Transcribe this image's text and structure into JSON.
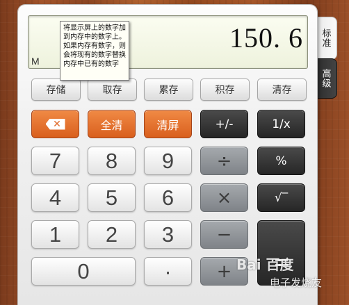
{
  "tabs": {
    "standard": "标准",
    "advanced": "高级"
  },
  "display": {
    "value": "150. 6",
    "memory_indicator": "M"
  },
  "tooltip": {
    "text": "将显示屏上的数字加到内存中的数字上。如果内存有数字，则会将现有的数字替换内存中已有的数字"
  },
  "memory_row": [
    "存储",
    "取存",
    "累存",
    "积存",
    "清存"
  ],
  "keys": {
    "backspace": "✕",
    "clear_all": "全清",
    "clear_screen": "清屏",
    "negate": "+/-",
    "reciprocal": "1/x",
    "seven": "7",
    "eight": "8",
    "nine": "9",
    "divide": "÷",
    "percent": "%",
    "four": "4",
    "five": "5",
    "six": "6",
    "multiply": "×",
    "sqrt": "√‾",
    "one": "1",
    "two": "2",
    "three": "3",
    "minus": "−",
    "zero": "0",
    "dot": "·",
    "plus": "+"
  },
  "watermark": {
    "brand": "Bai 百度",
    "sub": "电子发烧友"
  },
  "colors": {
    "accent_orange": "#e0682a",
    "dark_key": "#333333",
    "display_bg": "#f4f7e6"
  }
}
